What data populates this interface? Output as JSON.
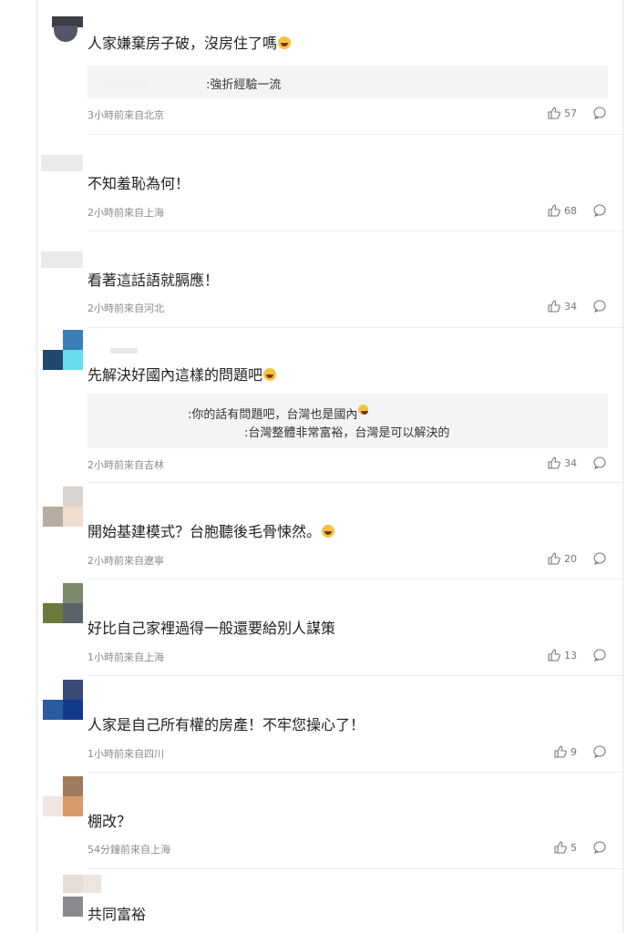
{
  "comments": [
    {
      "text": "人家嫌棄房子破，沒房住了嗎",
      "emoji": "laughing-crying-emoji",
      "reply_lines": [
        ":強折經驗一流"
      ],
      "meta": "3小時前來自北京",
      "likes": "57"
    },
    {
      "text": "不知羞恥為何！",
      "meta": "2小時前來自上海",
      "likes": "68"
    },
    {
      "text": "看著這話語就膈應！",
      "meta": "2小時前來自河北",
      "likes": "34"
    },
    {
      "text": "先解決好國內這樣的問題吧",
      "emoji": "laughing-crying-emoji",
      "reply_lines": [
        ":你的話有問題吧，台灣也是國內",
        ":台灣整體非常富裕，台灣是可以解決的"
      ],
      "meta": "2小時前來自吉林",
      "likes": "34"
    },
    {
      "text": "開始基建模式？台胞聽後毛骨悚然。",
      "emoji": "laughing-crying-emoji",
      "meta": "2小時前來自遼寧",
      "likes": "20"
    },
    {
      "text": "好比自己家裡過得一般還要給別人謀策",
      "meta": "1小時前來自上海",
      "likes": "13"
    },
    {
      "text": "人家是自己所有權的房產！不牢您操心了！",
      "meta": "1小時前來自四川",
      "likes": "9"
    },
    {
      "text": "棚改？",
      "meta": "54分鐘前來自上海",
      "likes": "5"
    },
    {
      "text": "共同富裕"
    }
  ],
  "colors": {
    "meta_text": "#8a8a8a",
    "reply_background": "#f4f4f6",
    "separator": "#ececec"
  },
  "icons": {
    "like": "thumbs-up-icon",
    "comment": "comment-bubble-icon"
  }
}
